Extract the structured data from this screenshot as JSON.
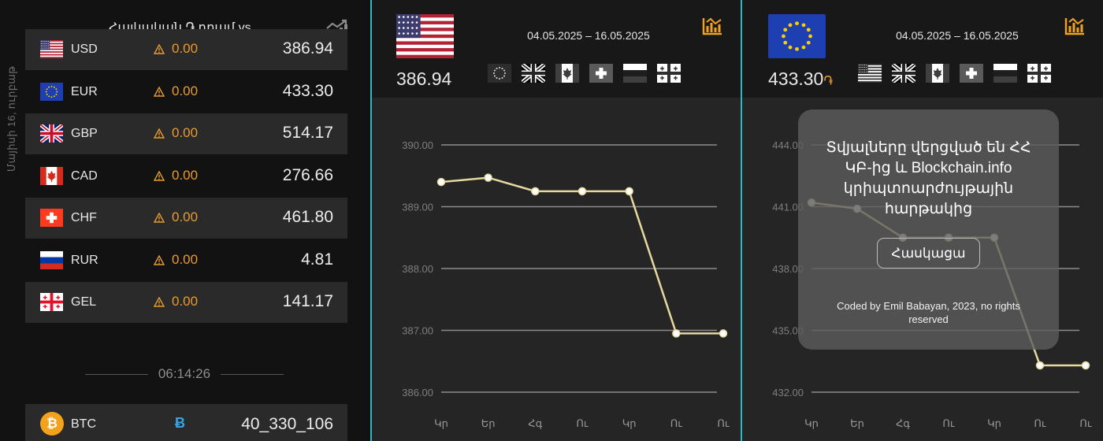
{
  "left": {
    "date_vertical": "Մայիսի 16, ուրբաթ",
    "title": "Հայկական ֏ դրամ vs...",
    "chart_icon": "trend-chart-icon",
    "rates": [
      {
        "code": "USD",
        "flag": "us-flag",
        "change": "0.00",
        "value": "386.94"
      },
      {
        "code": "EUR",
        "flag": "eu-flag",
        "change": "0.00",
        "value": "433.30"
      },
      {
        "code": "GBP",
        "flag": "uk-flag",
        "change": "0.00",
        "value": "514.17"
      },
      {
        "code": "CAD",
        "flag": "ca-flag",
        "change": "0.00",
        "value": "276.66"
      },
      {
        "code": "CHF",
        "flag": "ch-flag",
        "change": "0.00",
        "value": "461.80"
      },
      {
        "code": "RUR",
        "flag": "ru-flag",
        "change": "0.00",
        "value": "4.81"
      },
      {
        "code": "GEL",
        "flag": "ge-flag",
        "change": "0.00",
        "value": "141.17"
      }
    ],
    "clock": "06:14:26",
    "btc": {
      "code": "BTC",
      "coin_glyph": "₿",
      "symbol": "Ƀ",
      "value": "40_330_106"
    }
  },
  "colors": {
    "accent": "#e89a2c",
    "divider": "#2bb9c4",
    "line": "#e6d9a0",
    "btc": "#3aa3e3"
  },
  "usd_panel": {
    "big_rate": "386.94",
    "date_range": "04.05.2025 – 16.05.2025",
    "flag": "us-flag",
    "mini_flags": [
      "eu-flag",
      "uk-flag",
      "ca-flag",
      "ch-flag",
      "ru-flag",
      "ge-flag"
    ]
  },
  "eur_panel": {
    "big_rate": "433.30",
    "currency_sign": "֏",
    "date_range": "04.05.2025 – 16.05.2025",
    "flag": "eu-flag",
    "mini_flags": [
      "us-flag",
      "uk-flag",
      "ca-flag",
      "ch-flag",
      "ru-flag",
      "ge-flag"
    ]
  },
  "popup": {
    "message": "Տվյալները վերցված են ՀՀ ԿԲ-ից և Blockchain.info կրիպտոարժույթային հարթակից",
    "button": "Հասկացա",
    "credit": "Coded by Emil Babayan, 2023, no rights reserved"
  },
  "chart_data": [
    {
      "type": "line",
      "x": [
        "Կր",
        "Եր",
        "Հգ",
        "Ու",
        "Կր",
        "Ու",
        "Ու"
      ],
      "values": [
        389.4,
        389.47,
        389.25,
        389.25,
        389.25,
        386.95,
        386.95
      ],
      "yticks": [
        "390.00",
        "389.00",
        "388.00",
        "387.00",
        "386.00"
      ],
      "ylim": [
        386,
        390
      ],
      "grid": true,
      "title": "",
      "xlabel": "",
      "ylabel": ""
    },
    {
      "type": "line",
      "x": [
        "Կր",
        "Եր",
        "Հգ",
        "Ու",
        "Կր",
        "Ու",
        "Ու"
      ],
      "values": [
        441.2,
        440.9,
        439.5,
        439.5,
        439.5,
        433.3,
        433.3
      ],
      "yticks": [
        "444.00",
        "441.00",
        "438.00",
        "435.00",
        "432.00"
      ],
      "ylim": [
        432,
        444
      ],
      "grid": true,
      "title": "",
      "xlabel": "",
      "ylabel": ""
    }
  ]
}
